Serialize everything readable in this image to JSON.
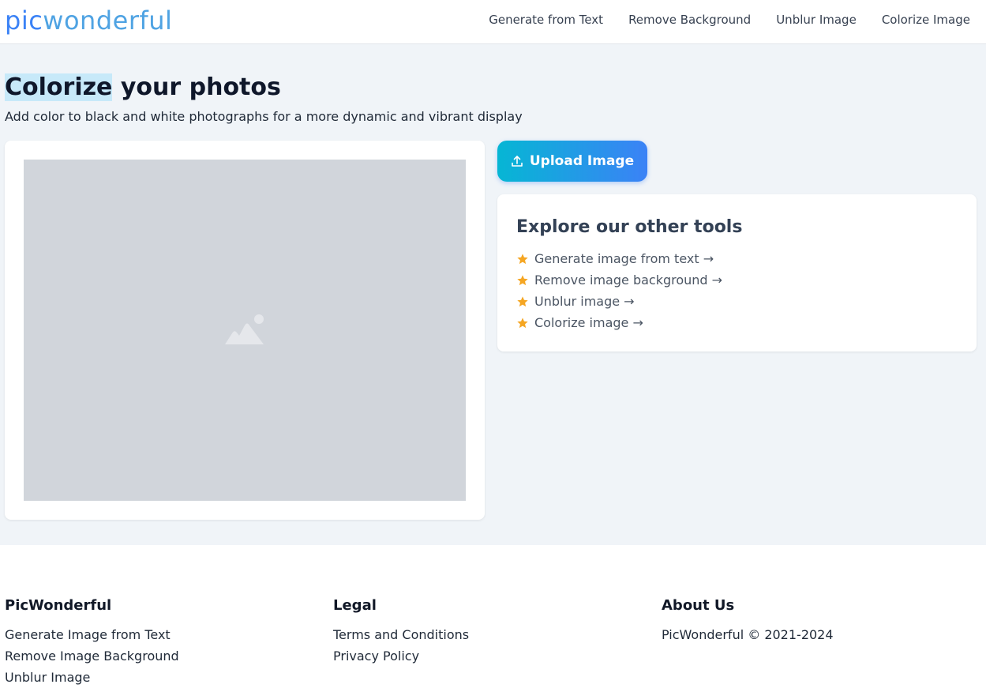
{
  "header": {
    "logo_pic": "pic",
    "logo_rest": "wonderful",
    "nav": [
      {
        "label": "Generate from Text"
      },
      {
        "label": "Remove Background"
      },
      {
        "label": "Unblur Image"
      },
      {
        "label": "Colorize Image"
      }
    ]
  },
  "hero": {
    "title_highlight": "Colorize",
    "title_rest": " your photos",
    "subtitle": "Add color to black and white photographs for a more dynamic and vibrant display"
  },
  "preview": {
    "icon": "image-placeholder-icon"
  },
  "upload": {
    "label": "Upload Image",
    "icon": "upload-icon"
  },
  "tools": {
    "heading": "Explore our other tools",
    "items": [
      {
        "label": "Generate image from text →"
      },
      {
        "label": "Remove image background →"
      },
      {
        "label": "Unblur image →"
      },
      {
        "label": "Colorize image →"
      }
    ]
  },
  "footer": {
    "col1": {
      "heading": "PicWonderful",
      "links": [
        "Generate Image from Text",
        "Remove Image Background",
        "Unblur Image"
      ]
    },
    "col2": {
      "heading": "Legal",
      "links": [
        "Terms and Conditions",
        "Privacy Policy"
      ]
    },
    "col3": {
      "heading": "About Us",
      "text": "PicWonderful © 2021-2024"
    }
  },
  "colors": {
    "accent_start": "#06b6d4",
    "accent_end": "#3b82f6",
    "star": "#f5a623",
    "highlight": "#c7e9f9",
    "page_bg": "#f0f4f8"
  }
}
